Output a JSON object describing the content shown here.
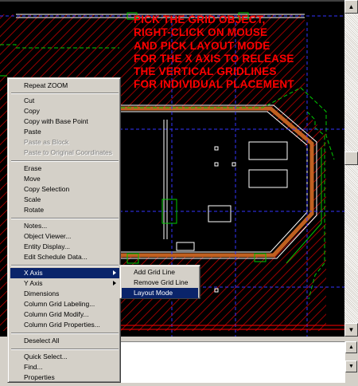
{
  "annotation": {
    "lines": [
      "PICK THE GRID OBJECT,",
      "RIGHT-CLICK ON MOUSE",
      "AND PICK LAYOUT MODE",
      "FOR THE X AXIS TO RELEASE",
      "THE VERTICAL GRIDLINES",
      "FOR INDIVIDUAL PLACEMENT"
    ]
  },
  "colors": {
    "canvas": "#000000",
    "hatch": "#c00000",
    "wall": "#ffffff",
    "grid_dashed": "#3333ff",
    "boundary": "#00cc00",
    "wall_fill": "#c06020",
    "annotation": "#ff0000",
    "menu_bg": "#d4d0c8",
    "menu_highlight": "#0a246a"
  },
  "context_menu": {
    "items": [
      {
        "label": "Repeat ZOOM",
        "enabled": true
      },
      {
        "label": "Cut",
        "enabled": true
      },
      {
        "label": "Copy",
        "enabled": true
      },
      {
        "label": "Copy with Base Point",
        "enabled": true
      },
      {
        "label": "Paste",
        "enabled": true
      },
      {
        "label": "Paste as Block",
        "enabled": false
      },
      {
        "label": "Paste to Original Coordinates",
        "enabled": false
      },
      {
        "label": "Erase",
        "enabled": true
      },
      {
        "label": "Move",
        "enabled": true
      },
      {
        "label": "Copy Selection",
        "enabled": true
      },
      {
        "label": "Scale",
        "enabled": true
      },
      {
        "label": "Rotate",
        "enabled": true
      },
      {
        "label": "Notes...",
        "enabled": true
      },
      {
        "label": "Object Viewer...",
        "enabled": true
      },
      {
        "label": "Entity Display...",
        "enabled": true
      },
      {
        "label": "Edit Schedule Data...",
        "enabled": true
      },
      {
        "label": "X Axis",
        "enabled": true,
        "highlighted": true,
        "submenu": true
      },
      {
        "label": "Y Axis",
        "enabled": true,
        "submenu": true
      },
      {
        "label": "Dimensions",
        "enabled": true
      },
      {
        "label": "Column Grid Labeling...",
        "enabled": true
      },
      {
        "label": "Column Grid Modify...",
        "enabled": true
      },
      {
        "label": "Column Grid Properties...",
        "enabled": true
      },
      {
        "label": "Deselect All",
        "enabled": true
      },
      {
        "label": "Quick Select...",
        "enabled": true
      },
      {
        "label": "Find...",
        "enabled": true
      },
      {
        "label": "Properties",
        "enabled": true
      }
    ]
  },
  "submenu": {
    "items": [
      {
        "label": "Add Grid Line"
      },
      {
        "label": "Remove Grid Line"
      },
      {
        "label": "Layout Mode",
        "highlighted": true
      }
    ]
  },
  "scrollbar": {
    "up_icon": "arrow-up-icon",
    "down_icon": "arrow-down-icon"
  }
}
